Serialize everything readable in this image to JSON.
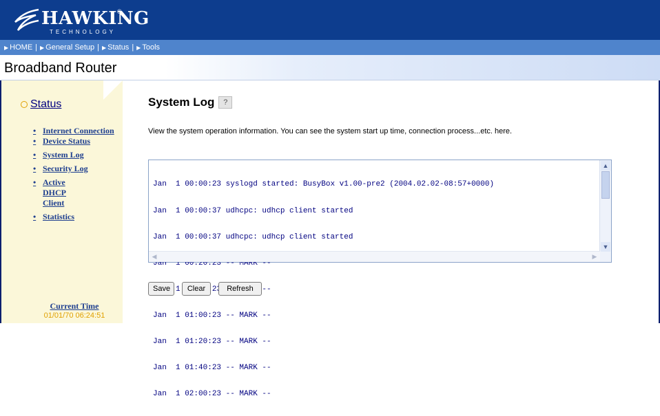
{
  "brand": {
    "logo_text": "HAWKING",
    "registered": "®",
    "tagline": "TECHNOLOGY"
  },
  "nav": [
    {
      "label": "HOME"
    },
    {
      "label": "General Setup"
    },
    {
      "label": "Status"
    },
    {
      "label": "Tools"
    }
  ],
  "header": {
    "title": "Broadband Router"
  },
  "sidebar": {
    "section": "Status",
    "items": [
      {
        "label": "Internet Connection"
      },
      {
        "label": "Device Status"
      },
      {
        "label": "System Log"
      },
      {
        "label": "Security Log"
      },
      {
        "label": "Active DHCP Client"
      },
      {
        "label": "Statistics"
      }
    ],
    "current_time_label": "Current Time",
    "current_time_value": "01/01/70 06:24:51"
  },
  "main": {
    "title": "System Log",
    "help_icon": "help-icon",
    "description": "View the system operation information. You can see the system start up time, connection process...etc. here.",
    "log_lines": [
      "Jan  1 00:00:23 syslogd started: BusyBox v1.00-pre2 (2004.02.02-08:57+0000)",
      "Jan  1 00:00:37 udhcpc: udhcp client started",
      "Jan  1 00:00:37 udhcpc: udhcp client started",
      "Jan  1 00:20:23 -- MARK --",
      "Jan  1 00:40:23 -- MARK --",
      "Jan  1 01:00:23 -- MARK --",
      "Jan  1 01:20:23 -- MARK --",
      "Jan  1 01:40:23 -- MARK --",
      "Jan  1 02:00:23 -- MARK --"
    ],
    "buttons": {
      "save": "Save",
      "clear": "Clear",
      "refresh": "Refresh"
    }
  },
  "colors": {
    "topbar": "#0d3d8e",
    "navbar": "#4f84cc",
    "sidebar_bg": "#fbf7d9",
    "link": "#1f3f8f",
    "time_value": "#e0a000"
  }
}
